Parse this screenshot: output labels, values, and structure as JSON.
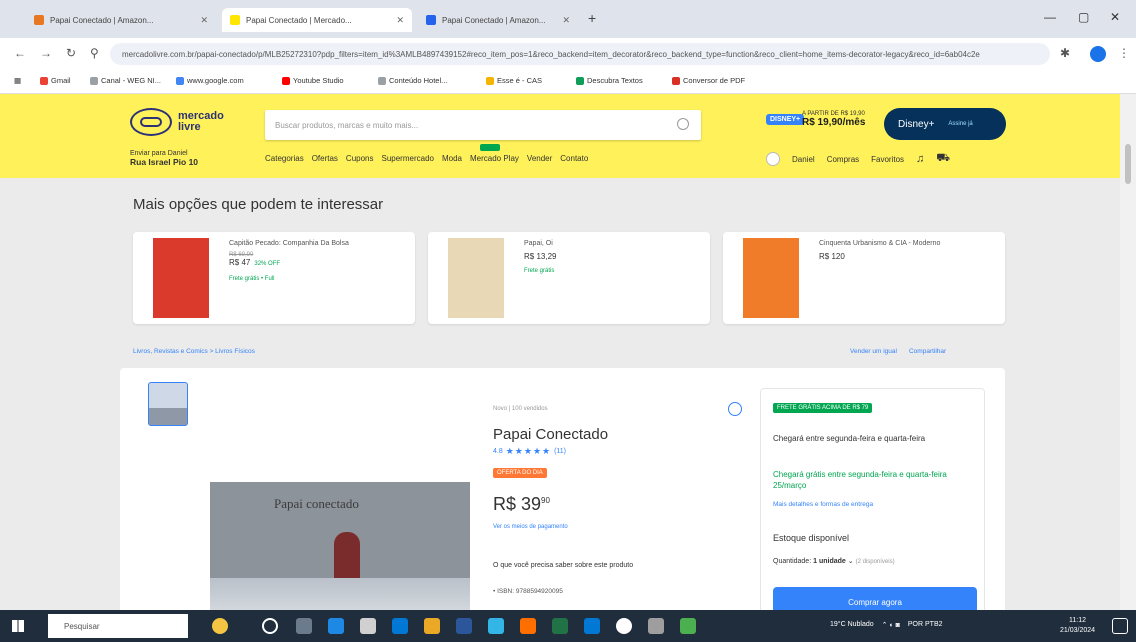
{
  "browser": {
    "tabs": [
      {
        "label": "Papai Conectado | Amazon...",
        "color": "#e87722",
        "active": false
      },
      {
        "label": "Papai Conectado | Mercado...",
        "color": "#ffe600",
        "active": true
      },
      {
        "label": "Papai Conectado | Amazon...",
        "color": "#2563eb",
        "active": false
      }
    ],
    "url": "mercadolivre.com.br/papai-conectado/p/MLB25272310?pdp_filters=item_id%3AMLB4897439152#reco_item_pos=1&reco_backend=item_decorator&reco_backend_type=function&reco_client=home_items-decorator-legacy&reco_id=6ab04c2e",
    "bookmarks": [
      "Gmail",
      "Canal - WEG NI...",
      "www.google.com",
      "Youtube Studio",
      "Conteúdo Hotel...",
      "Esse é - CAS",
      "Descubra Textos",
      "Conversor de PDF"
    ]
  },
  "header": {
    "logo_line1": "mercado",
    "logo_line2": "livre",
    "search_placeholder": "Buscar produtos, marcas e muito mais...",
    "promo_badge": "DISNEY+",
    "promo_caption": "A PARTIR DE R$ 19,90",
    "promo_price": "R$ 19,90/mês",
    "disney_label": "Disney+",
    "disney_sub": "Assine já",
    "location_line1": "Enviar para Daniel",
    "location_line2": "Rua Israel Pio 10",
    "nav": [
      "Categorias",
      "Ofertas",
      "Cupons",
      "Supermercado",
      "Moda",
      "Mercado Play",
      "Vender",
      "Contato"
    ],
    "user": [
      "Daniel",
      "Compras",
      "Favoritos"
    ]
  },
  "recommendations": {
    "title": "Mais opções que podem te interessar",
    "items": [
      {
        "title": "Capitão Pecado: Companhia Da Bolsa",
        "old_price": "R$ 69,90",
        "price": "R$ 47",
        "discount": "32% OFF",
        "shipping": "Frete grátis • Full",
        "cover_color": "#d93a2b"
      },
      {
        "title": "Papai, Oi",
        "old_price": "",
        "price": "R$ 13,29",
        "discount": "",
        "shipping": "Frete grátis",
        "cover_color": "#e8d8b6"
      },
      {
        "title": "Cinquenta Urbanismo & CIA - Moderno",
        "old_price": "",
        "price": "R$ 120",
        "discount": "",
        "shipping": "",
        "cover_color": "#f07c29"
      }
    ]
  },
  "breadcrumb": "Livros, Revistas e Comics > Livros Físicos",
  "share_links": [
    "Vender um igual",
    "Compartilhar"
  ],
  "product": {
    "condition": "Novo | 100 vendidos",
    "title": "Papai Conectado",
    "rating": "4.8",
    "stars": "★★★★★",
    "reviews": "(11)",
    "tag": "OFERTA DO DIA",
    "price": "R$ 39",
    "cents": "90",
    "installments": "Ver os meios de pagamento",
    "sell_text": "O que você precisa saber sobre este produto",
    "isbn": "• ISBN: 9788594920095",
    "cover_title": "Papai conectado"
  },
  "buybox": {
    "ship_badge": "FRETE GRÁTIS ACIMA DE R$ 79",
    "arrival": "Chegará entre segunda-feira e quarta-feira",
    "free": "Chegará grátis entre segunda-feira e quarta-feira 25/março",
    "more": "Mais detalhes e formas de entrega",
    "stock": "Estoque disponível",
    "qty_label": "Quantidade:",
    "qty_value": "1 unidade",
    "qty_avail": "(2 disponíveis)",
    "buy_label": "Comprar agora"
  },
  "taskbar": {
    "search": "Pesquisar",
    "weather": "19°C Nublado",
    "lang": "POR PTB2",
    "time": "11:12",
    "date": "21/03/2024"
  }
}
